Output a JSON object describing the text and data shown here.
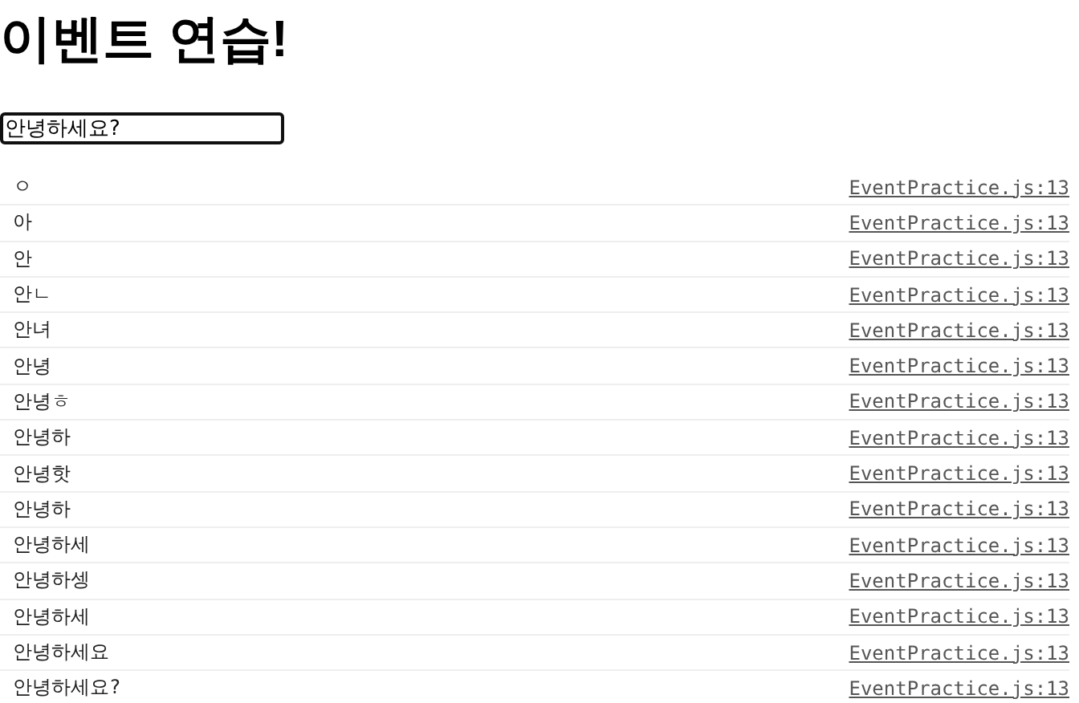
{
  "title": "이벤트 연습!",
  "input": {
    "value": "안녕하세요?",
    "focused": true
  },
  "console": [
    {
      "message": "ㅇ",
      "source": "EventPractice.js:13"
    },
    {
      "message": "아",
      "source": "EventPractice.js:13"
    },
    {
      "message": "안",
      "source": "EventPractice.js:13"
    },
    {
      "message": "안ㄴ",
      "source": "EventPractice.js:13"
    },
    {
      "message": "안녀",
      "source": "EventPractice.js:13"
    },
    {
      "message": "안녕",
      "source": "EventPractice.js:13"
    },
    {
      "message": "안녕ㅎ",
      "source": "EventPractice.js:13"
    },
    {
      "message": "안녕하",
      "source": "EventPractice.js:13"
    },
    {
      "message": "안녕핫",
      "source": "EventPractice.js:13"
    },
    {
      "message": "안녕하",
      "source": "EventPractice.js:13"
    },
    {
      "message": "안녕하세",
      "source": "EventPractice.js:13"
    },
    {
      "message": "안녕하셍",
      "source": "EventPractice.js:13"
    },
    {
      "message": "안녕하세",
      "source": "EventPractice.js:13"
    },
    {
      "message": "안녕하세요",
      "source": "EventPractice.js:13"
    },
    {
      "message": "안녕하세요?",
      "source": "EventPractice.js:13"
    }
  ]
}
